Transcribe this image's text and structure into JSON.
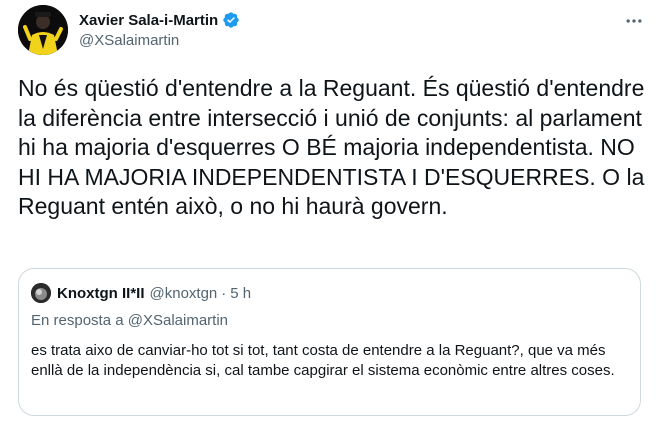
{
  "tweet": {
    "author": {
      "display_name": "Xavier Sala-i-Martin",
      "handle": "@XSalaimartin",
      "verified": true,
      "avatar_icon": "avatar-yellow-suit"
    },
    "more_icon": "more-horizontal-icon",
    "text": "No és qüestió d'entendre a la Reguant. És qüestió d'entendre la diferència entre intersecció i unió de conjunts: al parlament hi ha majoria d'esquerres O BÉ majoria independentista. NO HI HA MAJORIA INDEPENDENTISTA I D'ESQUERRES. O la Reguant entén això, o no hi haurà govern."
  },
  "quoted": {
    "display_name": "Knoxtgn II*II",
    "handle": "@knoxtgn",
    "separator": "·",
    "time": "5 h",
    "reply_prefix": "En resposta a",
    "reply_to": "@XSalaimartin",
    "text": "es trata aixo de canviar-ho tot si tot, tant costa de entendre a la Reguant?, que va més enllà de la independència si, cal tambe capgirar el sistema econòmic entre altres coses."
  },
  "colors": {
    "text_primary": "#0f1419",
    "text_secondary": "#536471",
    "border": "#cfd9de",
    "verified_blue": "#1d9bf0",
    "avatar_yellow": "#f2d31b"
  }
}
